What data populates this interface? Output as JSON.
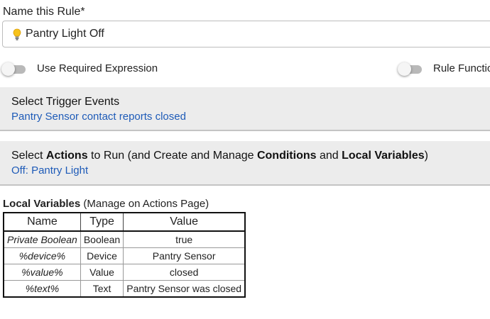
{
  "rule_name": {
    "label": "Name this Rule*",
    "value": "Pantry Light Off",
    "icon": "lightbulb-icon"
  },
  "toggles": {
    "required_expression": {
      "label": "Use Required Expression",
      "on": false
    },
    "rule_function": {
      "label": "Rule Function",
      "on": false
    }
  },
  "trigger_section": {
    "title": "Select Trigger Events",
    "summary": "Pantry Sensor contact reports closed"
  },
  "actions_section": {
    "title_prefix": "Select ",
    "title_actions": "Actions",
    "title_mid1": " to Run (and Create and Manage ",
    "title_conditions": "Conditions",
    "title_mid2": " and ",
    "title_local_vars": "Local Variables",
    "title_suffix": ")",
    "summary": "Off: Pantry Light"
  },
  "local_variables": {
    "title": "Local Variables",
    "subtitle": " (Manage on Actions Page)",
    "columns": [
      "Name",
      "Type",
      "Value"
    ],
    "rows": [
      {
        "name": "Private Boolean",
        "type": "Boolean",
        "value": "true"
      },
      {
        "name": "%device%",
        "type": "Device",
        "value": "Pantry Sensor"
      },
      {
        "name": "%value%",
        "type": "Value",
        "value": "closed"
      },
      {
        "name": "%text%",
        "type": "Text",
        "value": "Pantry Sensor was closed"
      }
    ]
  },
  "colors": {
    "link": "#1e5bb8",
    "section_bg": "#ececec",
    "toggle_track": "#b9b9b9"
  }
}
